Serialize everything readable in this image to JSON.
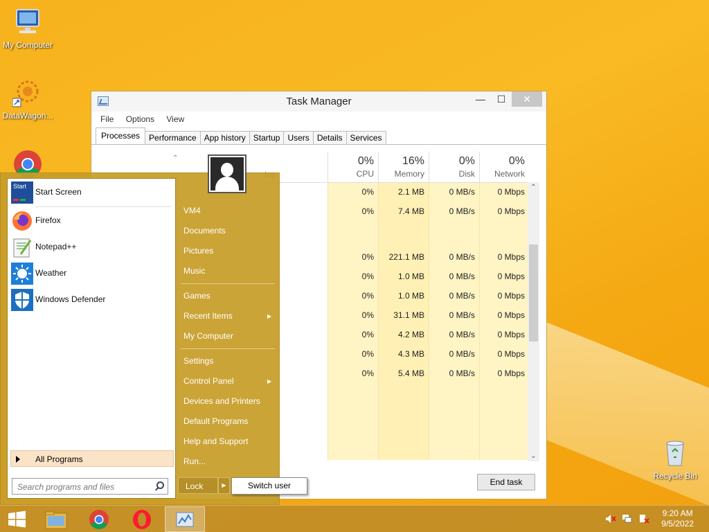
{
  "desktop": {
    "icons": [
      {
        "label": "My Computer"
      },
      {
        "label": "DataWagon..."
      },
      {
        "label": "Recycle Bin"
      }
    ]
  },
  "task_manager": {
    "title": "Task Manager",
    "menu": [
      "File",
      "Options",
      "View"
    ],
    "tabs": [
      "Processes",
      "Performance",
      "App history",
      "Startup",
      "Users",
      "Details",
      "Services"
    ],
    "active_tab": "Processes",
    "columns": [
      {
        "pct": "0%",
        "label": "CPU"
      },
      {
        "pct": "16%",
        "label": "Memory"
      },
      {
        "pct": "0%",
        "label": "Disk"
      },
      {
        "pct": "0%",
        "label": "Network"
      }
    ],
    "status_partial": "tus",
    "rows": [
      {
        "cpu": "0%",
        "mem": "2.1 MB",
        "disk": "0 MB/s",
        "net": "0 Mbps"
      },
      {
        "cpu": "0%",
        "mem": "7.4 MB",
        "disk": "0 MB/s",
        "net": "0 Mbps"
      },
      {
        "cpu": "0%",
        "mem": "221.1 MB",
        "disk": "0 MB/s",
        "net": "0 Mbps"
      },
      {
        "cpu": "0%",
        "mem": "1.0 MB",
        "disk": "0 MB/s",
        "net": "0 Mbps"
      },
      {
        "cpu": "0%",
        "mem": "1.0 MB",
        "disk": "0 MB/s",
        "net": "0 Mbps"
      },
      {
        "cpu": "0%",
        "mem": "31.1 MB",
        "disk": "0 MB/s",
        "net": "0 Mbps"
      },
      {
        "cpu": "0%",
        "mem": "4.2 MB",
        "disk": "0 MB/s",
        "net": "0 Mbps"
      },
      {
        "cpu": "0%",
        "mem": "4.3 MB",
        "disk": "0 MB/s",
        "net": "0 Mbps"
      },
      {
        "cpu": "0%",
        "mem": "5.4 MB",
        "disk": "0 MB/s",
        "net": "0 Mbps"
      }
    ],
    "end_task": "End task"
  },
  "start_menu": {
    "pinned": [
      {
        "label": "Start Screen",
        "icon": "start-screen-icon"
      },
      {
        "label": "Firefox",
        "icon": "firefox-icon"
      },
      {
        "label": "Notepad++",
        "icon": "notepadpp-icon"
      },
      {
        "label": "Weather",
        "icon": "weather-icon"
      },
      {
        "label": "Windows Defender",
        "icon": "defender-icon"
      }
    ],
    "start_tile_text": "Start",
    "all_programs": "All Programs",
    "search_placeholder": "Search programs and files",
    "right_links": [
      "VM4",
      "Documents",
      "Pictures",
      "Music",
      "Games",
      "Recent Items",
      "My Computer",
      "Settings",
      "Control Panel",
      "Devices and Printers",
      "Default Programs",
      "Help and Support",
      "Run..."
    ],
    "lock": "Lock",
    "switch_user": "Switch user"
  },
  "taskbar": {
    "time": "9:20 AM",
    "date": "9/5/2022"
  },
  "colors": {
    "accent": "#c79d28",
    "wallpaper": "#f7b21c",
    "tint": "#fff4c4"
  }
}
